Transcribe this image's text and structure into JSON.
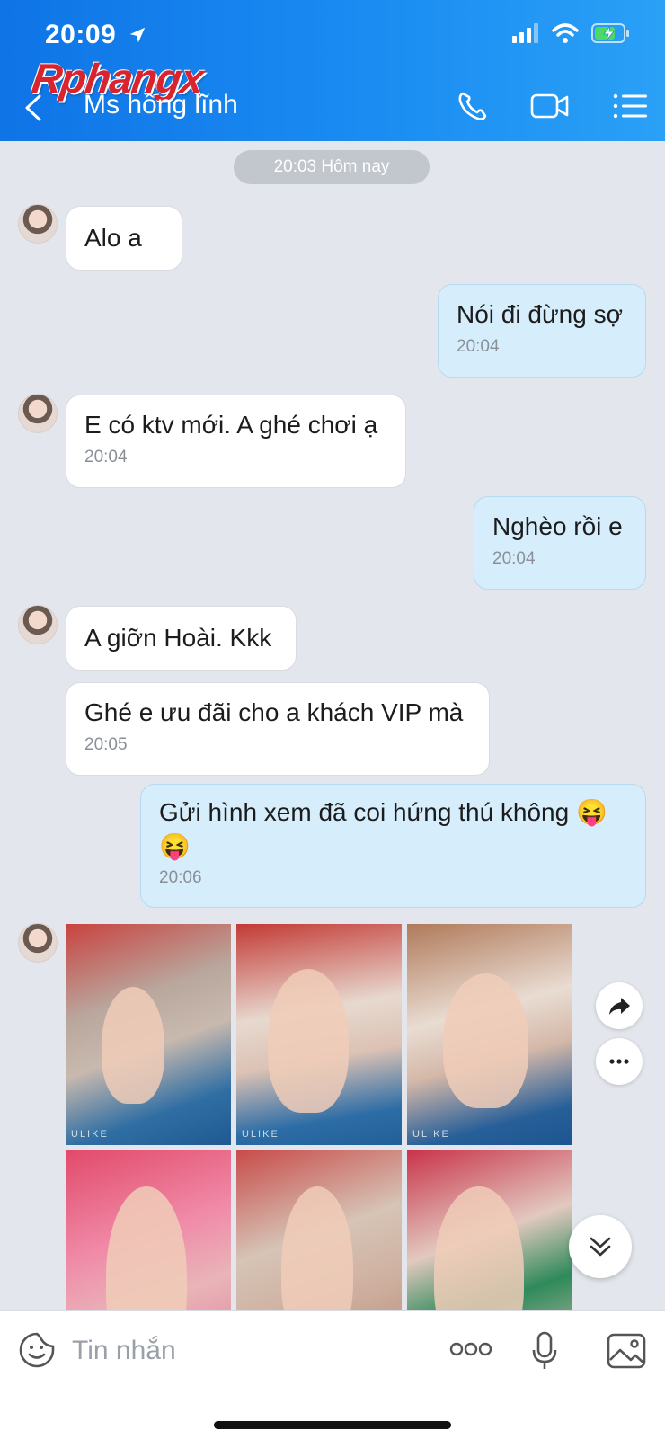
{
  "status_bar": {
    "time": "20:09"
  },
  "watermark": {
    "text": "Rphangx"
  },
  "header": {
    "contact_name": "Ms hồng lĩnh",
    "icons": [
      "back-icon",
      "phone-icon",
      "video-icon",
      "menu-icon"
    ]
  },
  "date_separator": "20:03 Hôm nay",
  "messages": [
    {
      "dir": "in",
      "text": "Alo a",
      "time": ""
    },
    {
      "dir": "out",
      "text": "Nói đi đừng sợ",
      "time": "20:04"
    },
    {
      "dir": "in",
      "text": "E có ktv mới. A ghé chơi ạ",
      "time": "20:04"
    },
    {
      "dir": "out",
      "text": "Nghèo rồi e",
      "time": "20:04"
    },
    {
      "dir": "in",
      "text": "A giỡn Hoài. Kkk",
      "time": ""
    },
    {
      "dir": "in",
      "text": "Ghé e ưu đãi cho a khách VIP mà",
      "time": "20:05"
    },
    {
      "dir": "out",
      "text": "Gửi hình xem đã coi hứng thú không 😝",
      "text2": "😝",
      "time": "20:06"
    }
  ],
  "photos": {
    "count": 6,
    "watermark": "ULIKE"
  },
  "composer": {
    "placeholder": "Tin nhắn",
    "icons": [
      "sticker-icon",
      "more-icon",
      "mic-icon",
      "gallery-icon"
    ]
  },
  "colors": {
    "header_gradient_start": "#0f74e6",
    "header_gradient_end": "#2aa0f6",
    "outgoing_bubble": "#d6eefc",
    "incoming_bubble": "#ffffff",
    "chat_background": "#e3e6ec"
  }
}
